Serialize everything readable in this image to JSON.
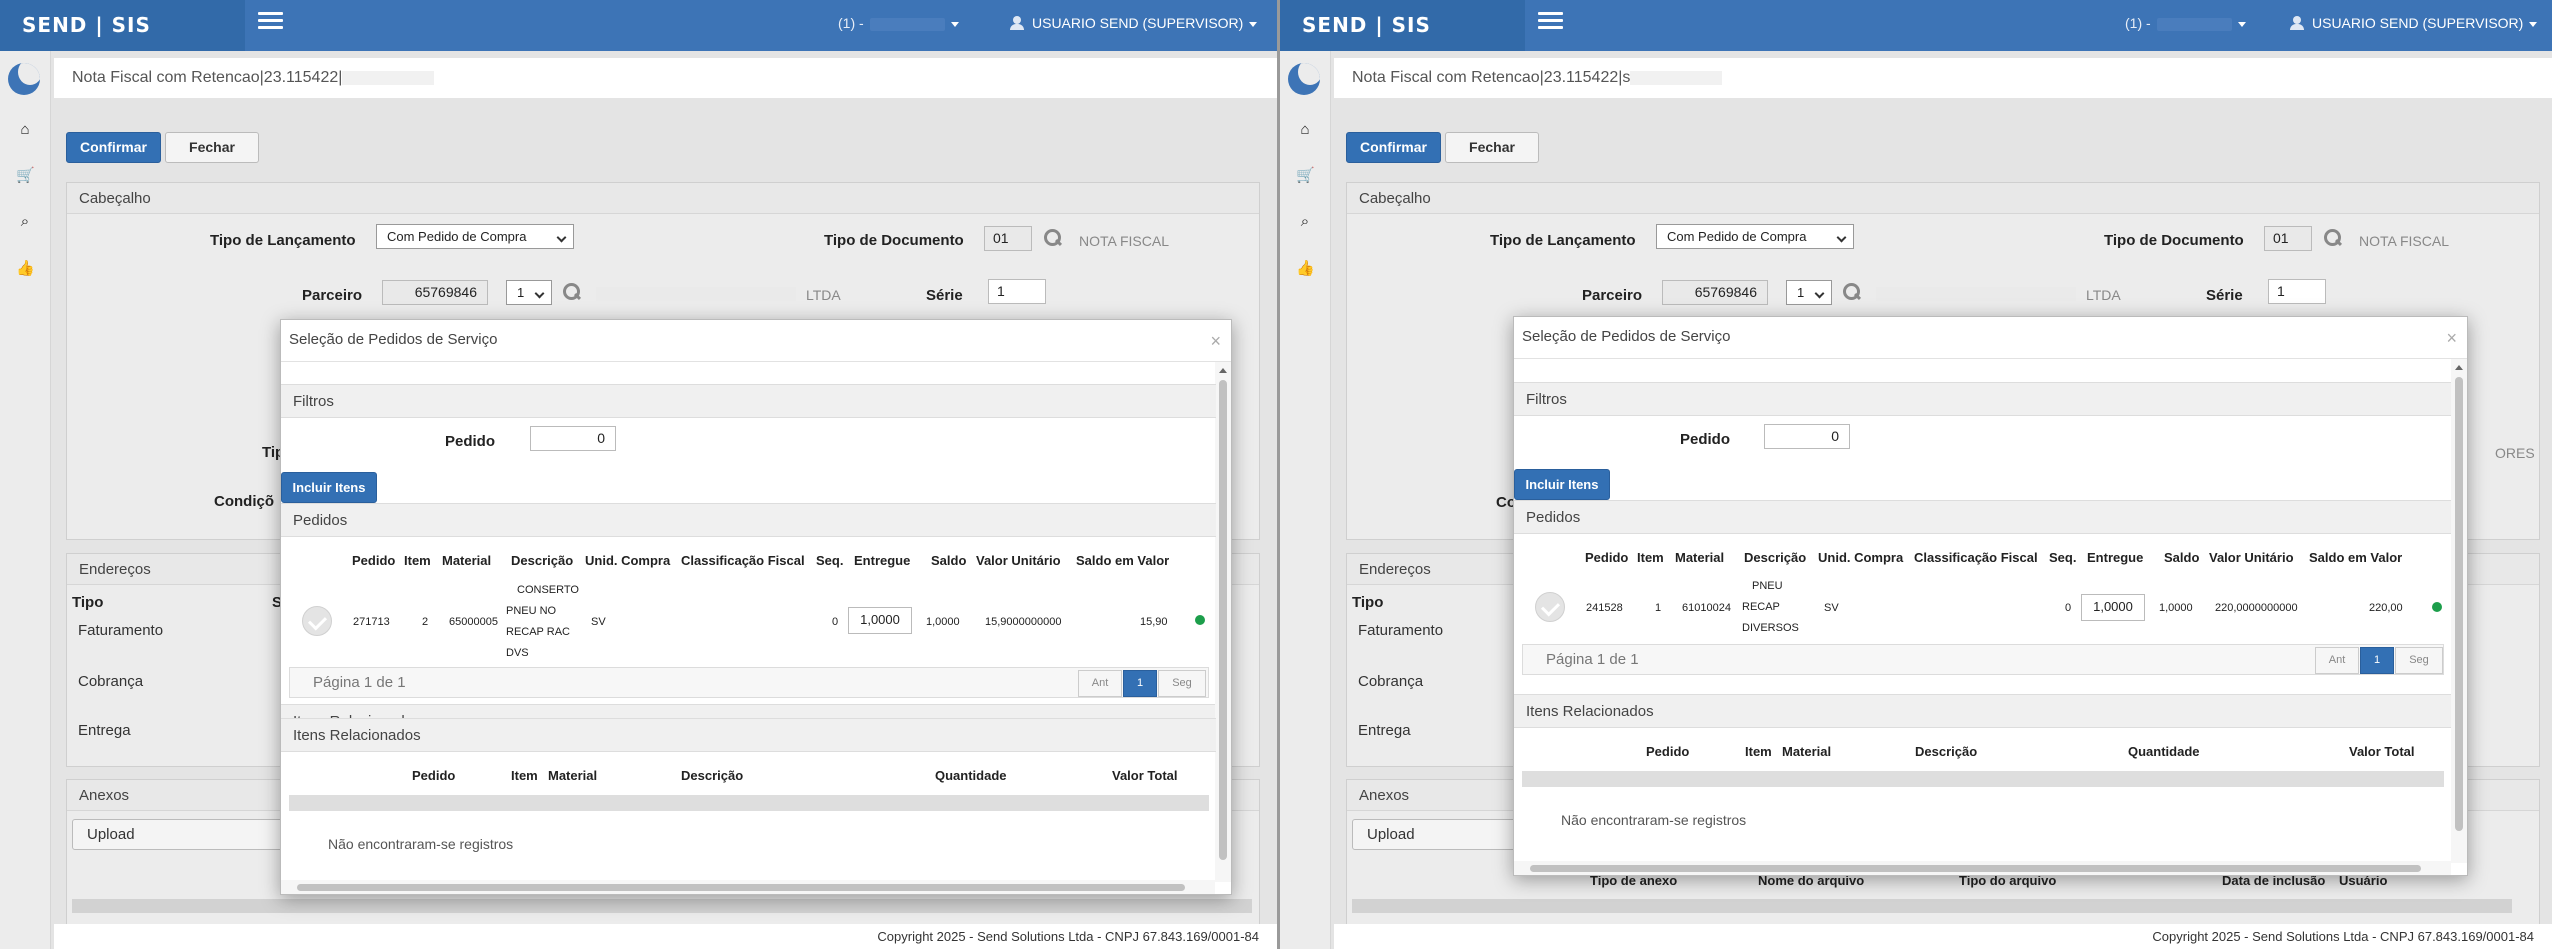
{
  "header": {
    "brand": "SEND | SIS",
    "environment": "(1) -",
    "user": "USUARIO SEND (SUPERVISOR)"
  },
  "page": {
    "title": "Nota Fiscal com Retencao|23.115422|",
    "title_b": "Nota Fiscal com Retencao|23.115422|s"
  },
  "actions": {
    "confirm": "Confirmar",
    "close": "Fechar"
  },
  "cabecalho": {
    "heading": "Cabeçalho",
    "tipo_lancamento_label": "Tipo de Lançamento",
    "tipo_lancamento_value": "Com Pedido de Compra",
    "tipo_documento_label": "Tipo de Documento",
    "tipo_documento_value": "01",
    "tipo_documento_desc": "NOTA FISCAL",
    "parceiro_label": "Parceiro",
    "parceiro_value": "65769846",
    "parceiro_seq": "1",
    "parceiro_suffix": "LTDA",
    "serie_label": "Série",
    "serie_value": "1",
    "tipo_partial": "Tip",
    "cond_partial": "Condiçõ",
    "co_partial": "Co",
    "ores_partial": "ORES"
  },
  "enderecos": {
    "heading": "Endereços",
    "tipo_label": "Tipo",
    "tipo_partial": "S",
    "faturamento": "Faturamento",
    "cobranca": "Cobrança",
    "entrega": "Entrega"
  },
  "anexos": {
    "heading": "Anexos",
    "upload": "Upload",
    "columns": [
      "Tipo de anexo",
      "Nome do arquivo",
      "Tipo do arquivo",
      "Data de inclusão",
      "Usuário"
    ]
  },
  "footer": {
    "copyright": "Copyright 2025 - Send Solutions Ltda - CNPJ 67.843.169/0001-84"
  },
  "modal": {
    "title": "Seleção de Pedidos de Serviço",
    "filtros_heading": "Filtros",
    "pedido_label": "Pedido",
    "pedido_value": "0",
    "include_button": "Incluir Itens",
    "pedidos_heading": "Pedidos",
    "columns": [
      "Pedido",
      "Item",
      "Material",
      "Descrição",
      "Unid. Compra",
      "Classificação Fiscal",
      "Seq.",
      "Entregue",
      "Saldo",
      "Valor Unitário",
      "Saldo em Valor"
    ],
    "page_info": "Página 1 de 1",
    "pager_prev": "Ant",
    "pager_current": "1",
    "pager_next": "Seg",
    "related_heading": "Itens Relacionados",
    "related_columns": [
      "Pedido",
      "Item",
      "Material",
      "Descrição",
      "Quantidade",
      "Valor Total"
    ],
    "empty": "Não encontraram-se registros"
  },
  "rows": {
    "a": {
      "pedido": "271713",
      "item": "2",
      "material": "65000005",
      "descricao": [
        "CONSERTO",
        "PNEU NO",
        "RECAP RAC",
        "DVS"
      ],
      "unid": "SV",
      "classificacao": "",
      "seq": "0",
      "entregue": "1,0000",
      "saldo": "1,0000",
      "valor_unitario": "15,9000000000",
      "saldo_valor": "15,90",
      "status_color": "#1c9e4b"
    },
    "b": {
      "pedido": "241528",
      "item": "1",
      "material": "61010024",
      "descricao": [
        "PNEU",
        "RECAP",
        "DIVERSOS"
      ],
      "unid": "SV",
      "classificacao": "",
      "seq": "0",
      "entregue": "1,0000",
      "saldo": "1,0000",
      "valor_unitario": "220,0000000000",
      "saldo_valor": "220,00",
      "status_color": "#1c9e4b"
    }
  },
  "icons": {
    "menu": "hamburger-icon",
    "home": "home-icon",
    "cart": "cart-icon",
    "search": "search-icon",
    "thumbs": "thumbs-up-icon",
    "user": "user-icon"
  }
}
